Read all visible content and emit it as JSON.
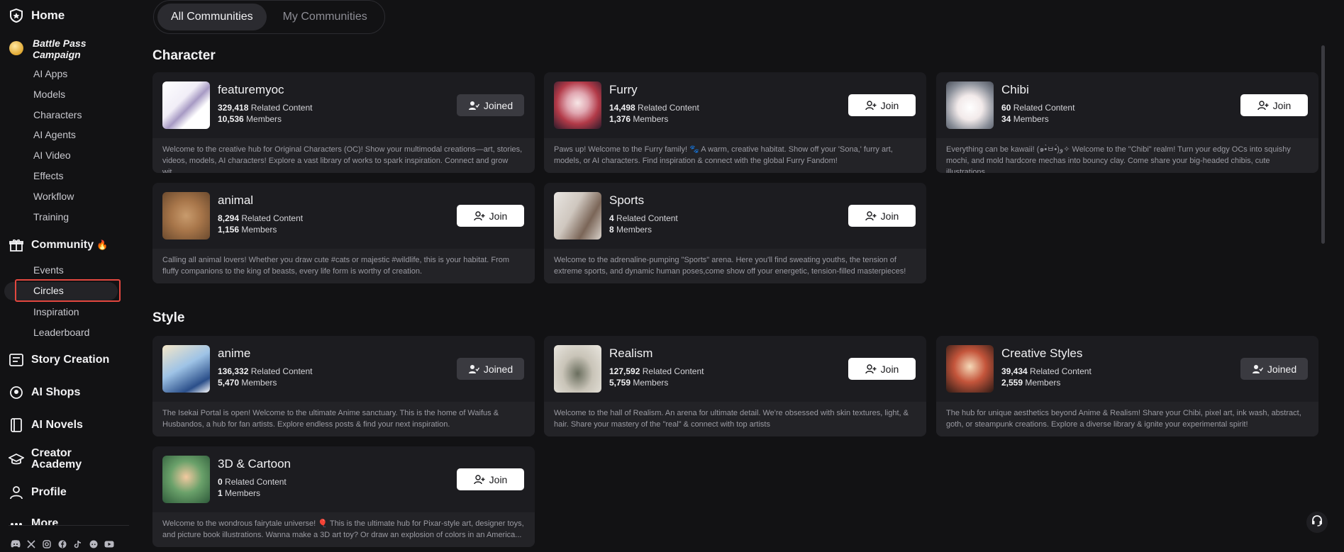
{
  "sidebar": {
    "home": "Home",
    "battle_pass": "Battle Pass Campaign",
    "ai_apps": "AI Apps",
    "models": "Models",
    "characters": "Characters",
    "ai_agents": "AI Agents",
    "ai_video": "AI Video",
    "effects": "Effects",
    "workflow": "Workflow",
    "training": "Training",
    "community": "Community",
    "events": "Events",
    "circles": "Circles",
    "inspiration": "Inspiration",
    "leaderboard": "Leaderboard",
    "story_creation": "Story Creation",
    "ai_shops": "AI Shops",
    "ai_novels": "AI Novels",
    "creator_academy": "Creator Academy",
    "profile": "Profile",
    "more": "More",
    "social_icons": [
      "discord-icon",
      "x-icon",
      "instagram-icon",
      "facebook-icon",
      "tiktok-icon",
      "reddit-icon",
      "youtube-icon"
    ]
  },
  "tabs": {
    "all": "All Communities",
    "my": "My Communities"
  },
  "sections": {
    "character": "Character",
    "style": "Style"
  },
  "labels": {
    "related": "Related Content",
    "members": "Members",
    "join": "Join",
    "joined": "Joined"
  },
  "cards": [
    {
      "name": "featuremyoc",
      "related": "329,418",
      "members": "10,536",
      "status": "Joined",
      "desc": "Welcome to the creative hub for Original Characters (OC)! Show your multimodal creations—art, stories, videos, models, AI characters! Explore a vast library of works to spark inspiration. Connect and grow wit..."
    },
    {
      "name": "Furry",
      "related": "14,498",
      "members": "1,376",
      "status": "Join",
      "desc": "Paws up! Welcome to the Furry family! 🐾 A warm, creative habitat. Show off your 'Sona,' furry art, models, or AI characters. Find inspiration & connect with the global Furry Fandom!"
    },
    {
      "name": "Chibi",
      "related": "60",
      "members": "34",
      "status": "Join",
      "desc": "Everything can be kawaii! (๑•̀ㅂ•́)و✧ Welcome to the \"Chibi\" realm! Turn your edgy OCs into squishy mochi, and mold hardcore mechas into bouncy clay. Come share your big-headed chibis, cute illustrations,"
    },
    {
      "name": "animal",
      "related": "8,294",
      "members": "1,156",
      "status": "Join",
      "desc": "Calling all animal lovers! Whether you draw cute #cats or majestic #wildlife, this is your habitat. From fluffy companions to the king of beasts, every life form is worthy of creation."
    },
    {
      "name": "Sports",
      "related": "4",
      "members": "8",
      "status": "Join",
      "desc": "Welcome to the adrenaline-pumping \"Sports\" arena. Here you'll find sweating youths, the tension of extreme sports, and dynamic human poses,come show off your energetic, tension-filled masterpieces!"
    },
    {
      "name": "anime",
      "related": "136,332",
      "members": "5,470",
      "status": "Joined",
      "desc": "The Isekai Portal is open! Welcome to the ultimate Anime sanctuary. This is the home of Waifus & Husbandos, a hub for fan artists. Explore endless posts & find your next inspiration."
    },
    {
      "name": "Realism",
      "related": "127,592",
      "members": "5,759",
      "status": "Join",
      "desc": "Welcome to the hall of Realism. An arena for ultimate detail. We're obsessed with skin textures, light, & hair. Share your mastery of the \"real\" & connect with top artists"
    },
    {
      "name": "Creative Styles",
      "related": "39,434",
      "members": "2,559",
      "status": "Joined",
      "desc": "The hub for unique aesthetics beyond Anime & Realism! Share your Chibi, pixel art, ink wash, abstract, goth, or steampunk creations. Explore a diverse library & ignite your experimental spirit!"
    },
    {
      "name": "3D & Cartoon",
      "related": "0",
      "members": "1",
      "status": "Join",
      "desc": "Welcome to the wondrous fairytale universe! 🎈 This is the ultimate hub for Pixar-style art, designer toys, and picture book illustrations. Wanna make a 3D art toy? Or draw an explosion of colors in an America..."
    }
  ]
}
